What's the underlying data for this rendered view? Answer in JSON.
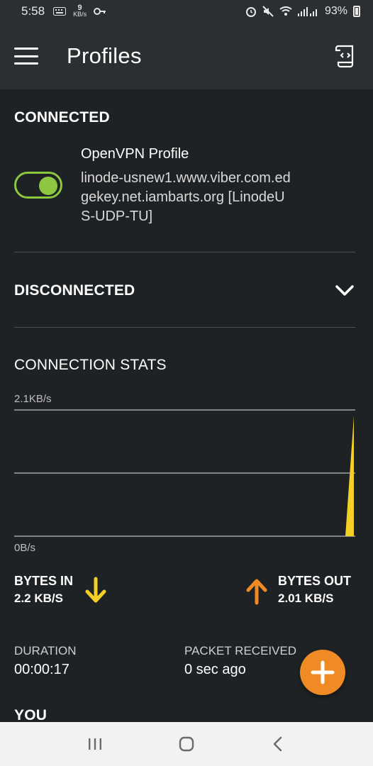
{
  "status_bar": {
    "time": "5:58",
    "speed_value": "9",
    "speed_unit": "KB/s",
    "battery": "93%"
  },
  "app_bar": {
    "title": "Profiles"
  },
  "connected": {
    "title": "CONNECTED",
    "profile": {
      "name": "OpenVPN Profile",
      "host": "linode-usnew1.www.viber.com.edgekey.net.iambarts.org [LinodeUS-UDP-TU]",
      "enabled": true
    }
  },
  "disconnected": {
    "title": "DISCONNECTED"
  },
  "stats": {
    "title": "CONNECTION STATS",
    "chart_data": {
      "type": "area",
      "y_max_label": "2.1KB/s",
      "y_min_label": "0B/s",
      "ylim": [
        0,
        2.1
      ],
      "series": [
        {
          "values": [
            0,
            0,
            0,
            0,
            0,
            0,
            0,
            0,
            0,
            0,
            0,
            0,
            0,
            0,
            0,
            0,
            0,
            0,
            0,
            2.0
          ]
        }
      ],
      "color": "#f2d024"
    },
    "bytes_in": {
      "label": "BYTES IN",
      "value": "2.2 KB/S",
      "color": "#f2d024"
    },
    "bytes_out": {
      "label": "BYTES OUT",
      "value": "2.01 KB/S",
      "color": "#f08a24"
    },
    "duration": {
      "label": "DURATION",
      "value": "00:00:17"
    },
    "packet_received": {
      "label": "PACKET RECEIVED",
      "value": "0 sec ago"
    }
  },
  "you": {
    "title": "YOU"
  },
  "colors": {
    "accent_green": "#8dc63f",
    "accent_orange": "#f08a24",
    "accent_yellow": "#f2d024"
  }
}
